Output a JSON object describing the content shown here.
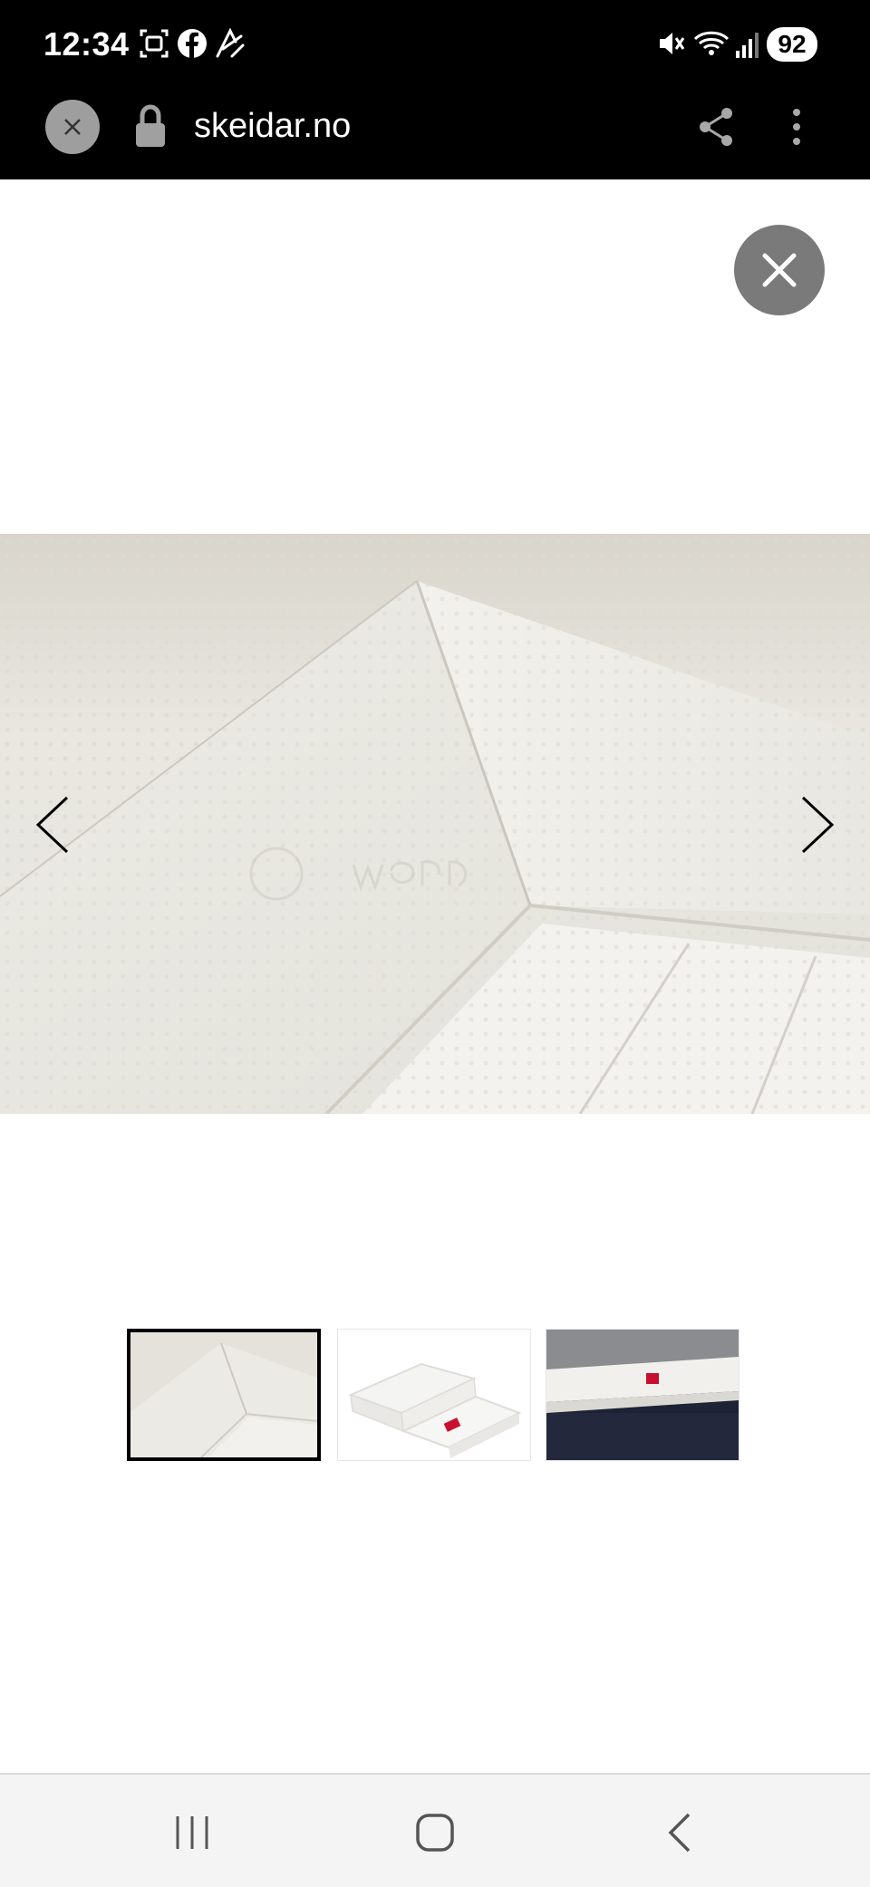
{
  "status_bar": {
    "time": "12:34",
    "battery": "92",
    "icons": [
      "screenshot-icon",
      "facebook-icon",
      "notes-icon",
      "mute-icon",
      "wifi-icon",
      "signal-icon"
    ]
  },
  "browser": {
    "url": "skeidar.no",
    "icons": [
      "close-tab-icon",
      "lock-icon",
      "share-icon",
      "more-vertical-icon"
    ]
  },
  "viewer": {
    "close_icon": "close-icon",
    "prev_icon": "chevron-left-icon",
    "next_icon": "chevron-right-icon",
    "selected_thumbnail_index": 0,
    "thumbnail_count": 3
  },
  "bottom_nav": {
    "icons": [
      "recent-apps-icon",
      "home-icon",
      "back-icon"
    ]
  }
}
